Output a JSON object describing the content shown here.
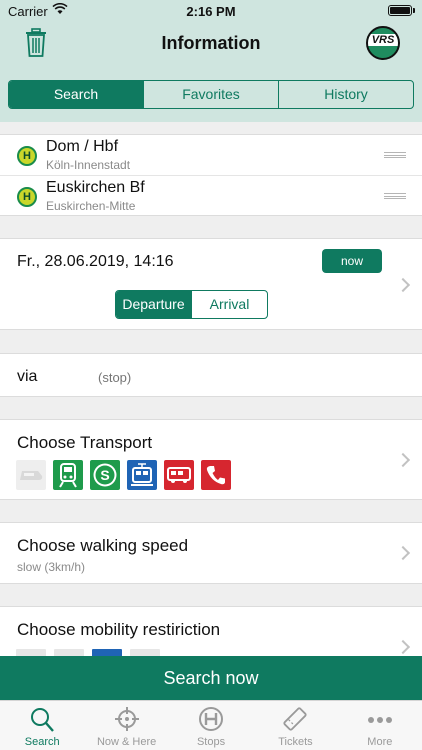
{
  "status_bar": {
    "carrier": "Carrier",
    "time": "2:16 PM"
  },
  "header": {
    "title": "Information",
    "logo_text": "VRS",
    "tabs": [
      {
        "label": "Search",
        "active": true
      },
      {
        "label": "Favorites",
        "active": false
      },
      {
        "label": "History",
        "active": false
      }
    ]
  },
  "stops": [
    {
      "badge": "H",
      "name": "Dom / Hbf",
      "area": "Köln-Innenstadt"
    },
    {
      "badge": "H",
      "name": "Euskirchen Bf",
      "area": "Euskirchen-Mitte"
    }
  ],
  "datetime": {
    "value": "Fr., 28.06.2019, 14:16",
    "now_label": "now",
    "departure_label": "Departure",
    "arrival_label": "Arrival",
    "selected": "Departure"
  },
  "via": {
    "label": "via",
    "placeholder": "(stop)"
  },
  "transport": {
    "title": "Choose Transport",
    "icons": [
      {
        "icon": "long-distance-train-icon",
        "color": "#eeeeee",
        "enabled": false
      },
      {
        "icon": "regional-train-icon",
        "color": "#1e9b4b",
        "enabled": true
      },
      {
        "icon": "s-bahn-icon",
        "color": "#1e9b4b",
        "letter": "S",
        "enabled": true
      },
      {
        "icon": "tram-icon",
        "color": "#1f64b5",
        "enabled": true
      },
      {
        "icon": "bus-icon",
        "color": "#d6262f",
        "enabled": true
      },
      {
        "icon": "on-demand-phone-icon",
        "color": "#d6262f",
        "enabled": true
      }
    ]
  },
  "walking": {
    "title": "Choose walking speed",
    "value": "slow (3km/h)"
  },
  "mobility": {
    "title": "Choose mobility restiriction",
    "icons": [
      {
        "icon": "mobility-option-1-icon",
        "enabled": false
      },
      {
        "icon": "mobility-option-2-icon",
        "enabled": false
      },
      {
        "icon": "wheelchair-icon",
        "enabled": true
      },
      {
        "icon": "mobility-option-4-icon",
        "enabled": false
      }
    ]
  },
  "search_button": "Search now",
  "tabbar": [
    {
      "label": "Search",
      "icon": "search-icon",
      "active": true
    },
    {
      "label": "Now & Here",
      "icon": "crosshair-icon",
      "active": false
    },
    {
      "label": "Stops",
      "icon": "stop-h-icon",
      "active": false
    },
    {
      "label": "Tickets",
      "icon": "ticket-icon",
      "active": false
    },
    {
      "label": "More",
      "icon": "more-dots-icon",
      "active": false
    }
  ],
  "colors": {
    "accent": "#0f7a60",
    "header_bg": "#cfe5df",
    "stop_badge": "#c9d72a"
  }
}
